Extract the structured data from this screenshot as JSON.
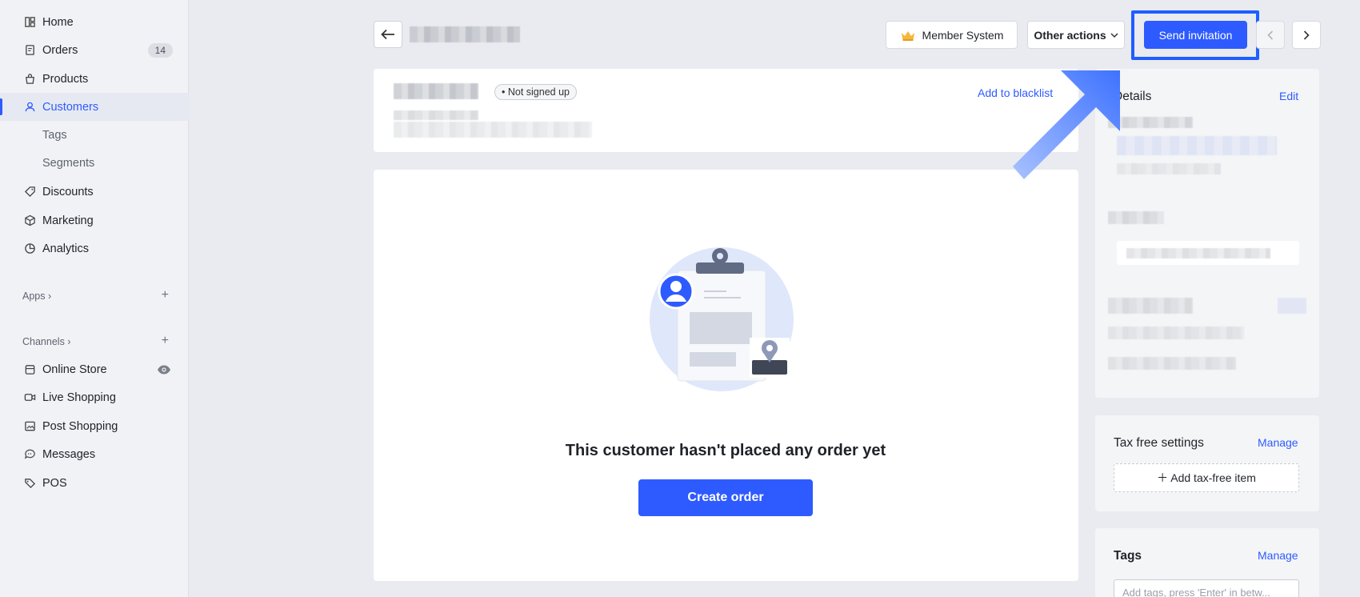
{
  "sidebar": {
    "items": [
      {
        "label": "Home",
        "icon": "home-icon"
      },
      {
        "label": "Orders",
        "icon": "orders-icon",
        "badge": "14"
      },
      {
        "label": "Products",
        "icon": "bag-icon"
      },
      {
        "label": "Customers",
        "icon": "user-icon",
        "active": true
      },
      {
        "label": "Discounts",
        "icon": "tag-icon"
      },
      {
        "label": "Marketing",
        "icon": "cube-icon"
      },
      {
        "label": "Analytics",
        "icon": "pie-chart-icon"
      }
    ],
    "sub_items": [
      "Tags",
      "Segments"
    ],
    "apps_label": "Apps ›",
    "channels_label": "Channels ›",
    "channels": [
      {
        "label": "Online Store",
        "icon": "store-icon"
      },
      {
        "label": "Live Shopping",
        "icon": "video-icon"
      },
      {
        "label": "Post Shopping",
        "icon": "image-icon"
      },
      {
        "label": "Messages",
        "icon": "chat-icon"
      },
      {
        "label": "POS",
        "icon": "pos-tag-icon"
      }
    ]
  },
  "topbar": {
    "member_system": "Member System",
    "other_actions": "Other actions",
    "send_invitation": "Send invitation"
  },
  "customer": {
    "status_badge": "• Not signed up",
    "blacklist_link": "Add to blacklist"
  },
  "orders": {
    "empty_title": "This customer hasn't placed any order yet",
    "create_order": "Create order"
  },
  "details": {
    "title": "Details",
    "edit": "Edit"
  },
  "tax": {
    "title": "Tax free settings",
    "manage": "Manage",
    "add_item": "＋ Add tax-free item"
  },
  "tags": {
    "title": "Tags",
    "manage": "Manage",
    "placeholder": "Add tags, press 'Enter' in betw..."
  },
  "colors": {
    "accent": "#2e5bff",
    "highlight_border": "#1f5eff"
  }
}
